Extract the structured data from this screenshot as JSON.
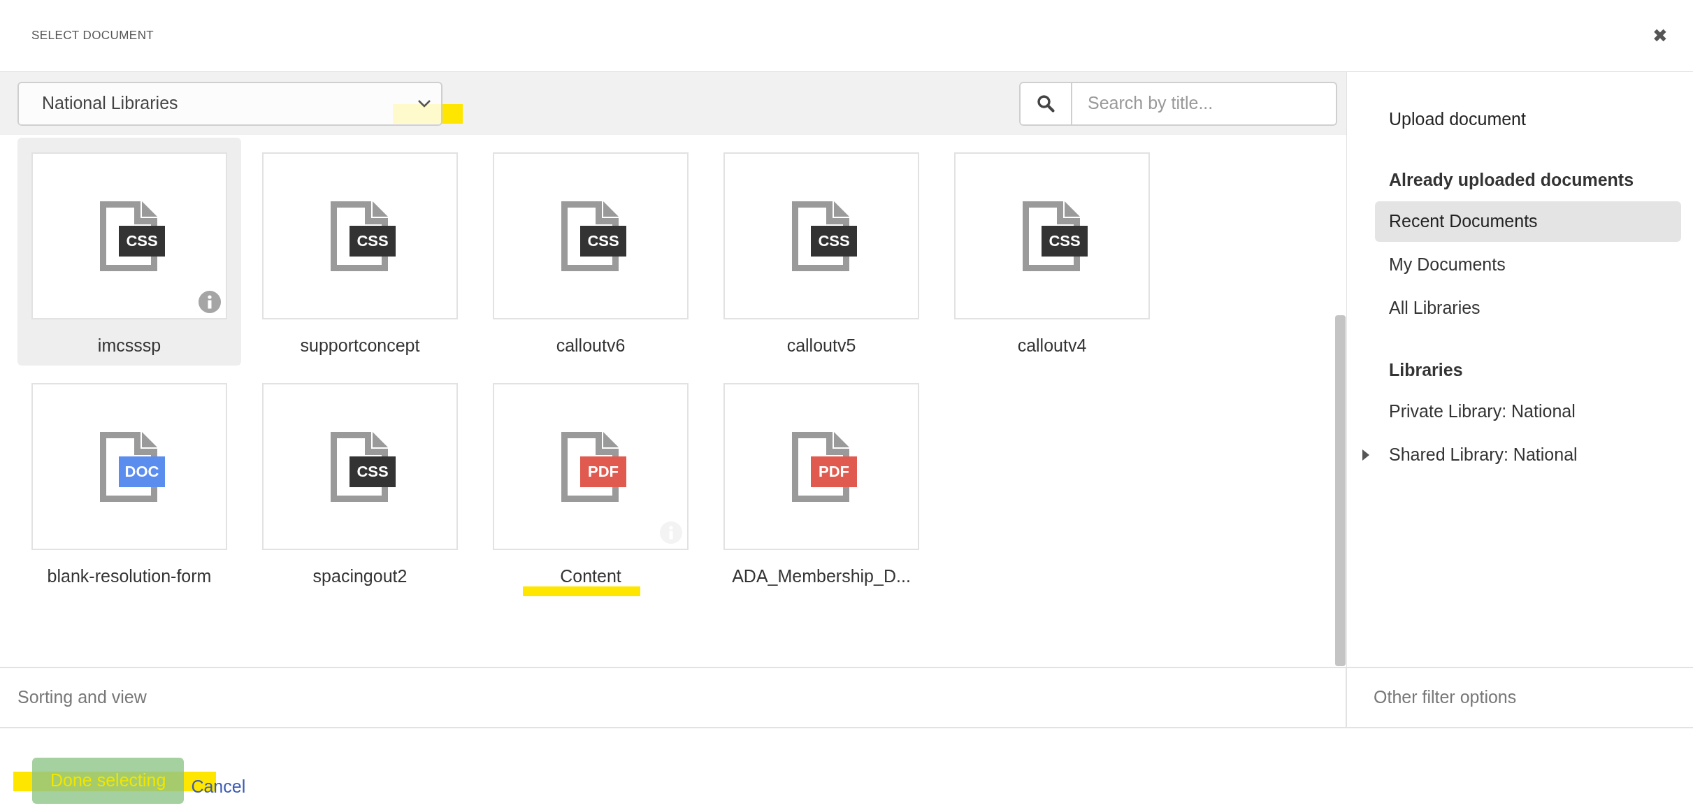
{
  "window": {
    "title": "SELECT DOCUMENT",
    "close": "✖"
  },
  "library_select": {
    "value": "National Libraries"
  },
  "search": {
    "placeholder": "Search by title..."
  },
  "documents": [
    {
      "name": "imcsssp",
      "type": "CSS",
      "selected": true,
      "info_shown": true,
      "info_dimmed": false
    },
    {
      "name": "supportconcept",
      "type": "CSS",
      "selected": false
    },
    {
      "name": "calloutv6",
      "type": "CSS",
      "selected": false
    },
    {
      "name": "calloutv5",
      "type": "CSS",
      "selected": false
    },
    {
      "name": "calloutv4",
      "type": "CSS",
      "selected": false
    },
    {
      "name": "blank-resolution-form",
      "type": "DOC",
      "selected": false
    },
    {
      "name": "spacingout2",
      "type": "CSS",
      "selected": false
    },
    {
      "name": "Content",
      "type": "PDF",
      "selected": false,
      "info_shown": true,
      "info_dimmed": true
    },
    {
      "name": "ADA_Membership_D...",
      "type": "PDF",
      "selected": false
    }
  ],
  "sidebar": {
    "items": [
      {
        "kind": "link",
        "label": "Upload document"
      },
      {
        "kind": "heading",
        "label": "Already uploaded documents"
      },
      {
        "kind": "item",
        "label": "Recent Documents",
        "selected": true
      },
      {
        "kind": "item",
        "label": "My Documents",
        "selected": false
      },
      {
        "kind": "item",
        "label": "All Libraries",
        "selected": false
      },
      {
        "kind": "heading",
        "label": "Libraries"
      },
      {
        "kind": "item",
        "label": "Private Library: National",
        "selected": false
      },
      {
        "kind": "tree",
        "label": "Shared Library: National",
        "selected": false,
        "expanded": false
      }
    ]
  },
  "sorting": {
    "label": "Sorting and view"
  },
  "filters": {
    "label": "Other filter options"
  },
  "buttons": {
    "done": "Done selecting",
    "cancel": "Cancel"
  }
}
